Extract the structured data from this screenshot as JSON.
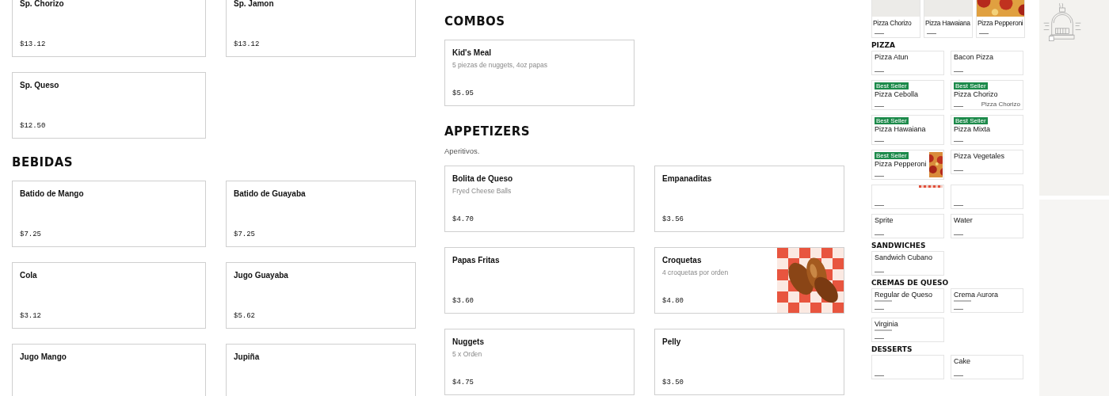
{
  "left_column": {
    "items": [
      {
        "name": "Sp. Chorizo",
        "price": "$13.12",
        "kind": "plain"
      },
      {
        "name": "Sp. Jamon",
        "price": "$13.12",
        "kind": "plain"
      },
      {
        "name": "Sp. Queso",
        "price": "$12.50",
        "kind": "plain"
      }
    ],
    "sections": [
      {
        "title": "BEBIDAS",
        "items": [
          {
            "name": "Batido de Mango",
            "price": "$7.25",
            "kind": "plain"
          },
          {
            "name": "Batido de Guayaba",
            "price": "$7.25",
            "kind": "plain"
          },
          {
            "name": "Cola",
            "price": "$3.12",
            "kind": "plain"
          },
          {
            "name": "Jugo Guayaba",
            "price": "$5.62",
            "kind": "plain"
          },
          {
            "name": "Jugo Mango",
            "kind": "plain"
          },
          {
            "name": "Jupiña",
            "kind": "plain"
          }
        ]
      }
    ]
  },
  "middle_column": {
    "sections": [
      {
        "title": "COMBOS",
        "items": [
          {
            "name": "Kid's Meal",
            "description": "5 piezas de nuggets, 4oz papas",
            "price": "$5.95",
            "kind": "plain"
          }
        ]
      },
      {
        "title": "APPETIZERS",
        "subtitle": "Aperitivos.",
        "items": [
          {
            "name": "Bolita de Queso",
            "description": "Fryed Cheese Balls",
            "price": "$4.70",
            "kind": "plain"
          },
          {
            "name": "Empanaditas",
            "price": "$3.56",
            "kind": "plain"
          },
          {
            "name": "Papas Fritas",
            "price": "$3.60",
            "kind": "plain"
          },
          {
            "name": "Croquetas",
            "description": "4 croquetas por orden",
            "price": "$4.80",
            "kind": "picture"
          },
          {
            "name": "Nuggets",
            "description": "5 x Orden",
            "price": "$4.75",
            "kind": "plain"
          },
          {
            "name": "Pelly",
            "price": "$3.50",
            "kind": "plain"
          }
        ]
      }
    ]
  },
  "preview": {
    "top_items": [
      {
        "name": "Pizza Chorizo",
        "kind": "blank"
      },
      {
        "name": "Pizza Hawaiana",
        "kind": "blank"
      },
      {
        "name": "Pizza Pepperoni",
        "kind": "picture"
      }
    ],
    "sections": [
      {
        "title": "PIZZA",
        "items": [
          {
            "name": "Pizza Atun",
            "kind": "plain"
          },
          {
            "name": "Bacon Pizza",
            "kind": "plain"
          },
          {
            "name": "Pizza Cebolla",
            "badge": "Best Seller",
            "kind": "plain"
          },
          {
            "name": "Pizza Chorizo",
            "badge": "Best Seller",
            "kind": "broken",
            "alt": "Pizza Chorizo"
          },
          {
            "name": "Pizza Hawaiana",
            "badge": "Best Seller",
            "kind": "plain"
          },
          {
            "name": "Pizza Mixta",
            "badge": "Best Seller",
            "kind": "plain"
          },
          {
            "name": "Pizza Pepperoni",
            "badge": "Best Seller",
            "kind": "picture"
          },
          {
            "name": "Pizza Vegetales",
            "kind": "plain"
          },
          {
            "kind": "strip"
          },
          {
            "kind": "plain"
          },
          {
            "name": "Sprite",
            "kind": "plain"
          },
          {
            "name": "Water",
            "kind": "plain"
          }
        ]
      },
      {
        "title": "SANDWICHES",
        "items": [
          {
            "name": "Sandwich Cubano",
            "kind": "plain"
          }
        ]
      },
      {
        "title": "CREMAS DE QUESO",
        "items": [
          {
            "name": "Regular de Queso",
            "kind": "described"
          },
          {
            "name": "Crema Aurora",
            "kind": "described"
          },
          {
            "name": "Virginia",
            "kind": "described"
          }
        ]
      },
      {
        "title": "DESSERTS",
        "items": [
          {
            "kind": "plain"
          },
          {
            "name": "Cake",
            "kind": "plain"
          }
        ]
      }
    ]
  }
}
